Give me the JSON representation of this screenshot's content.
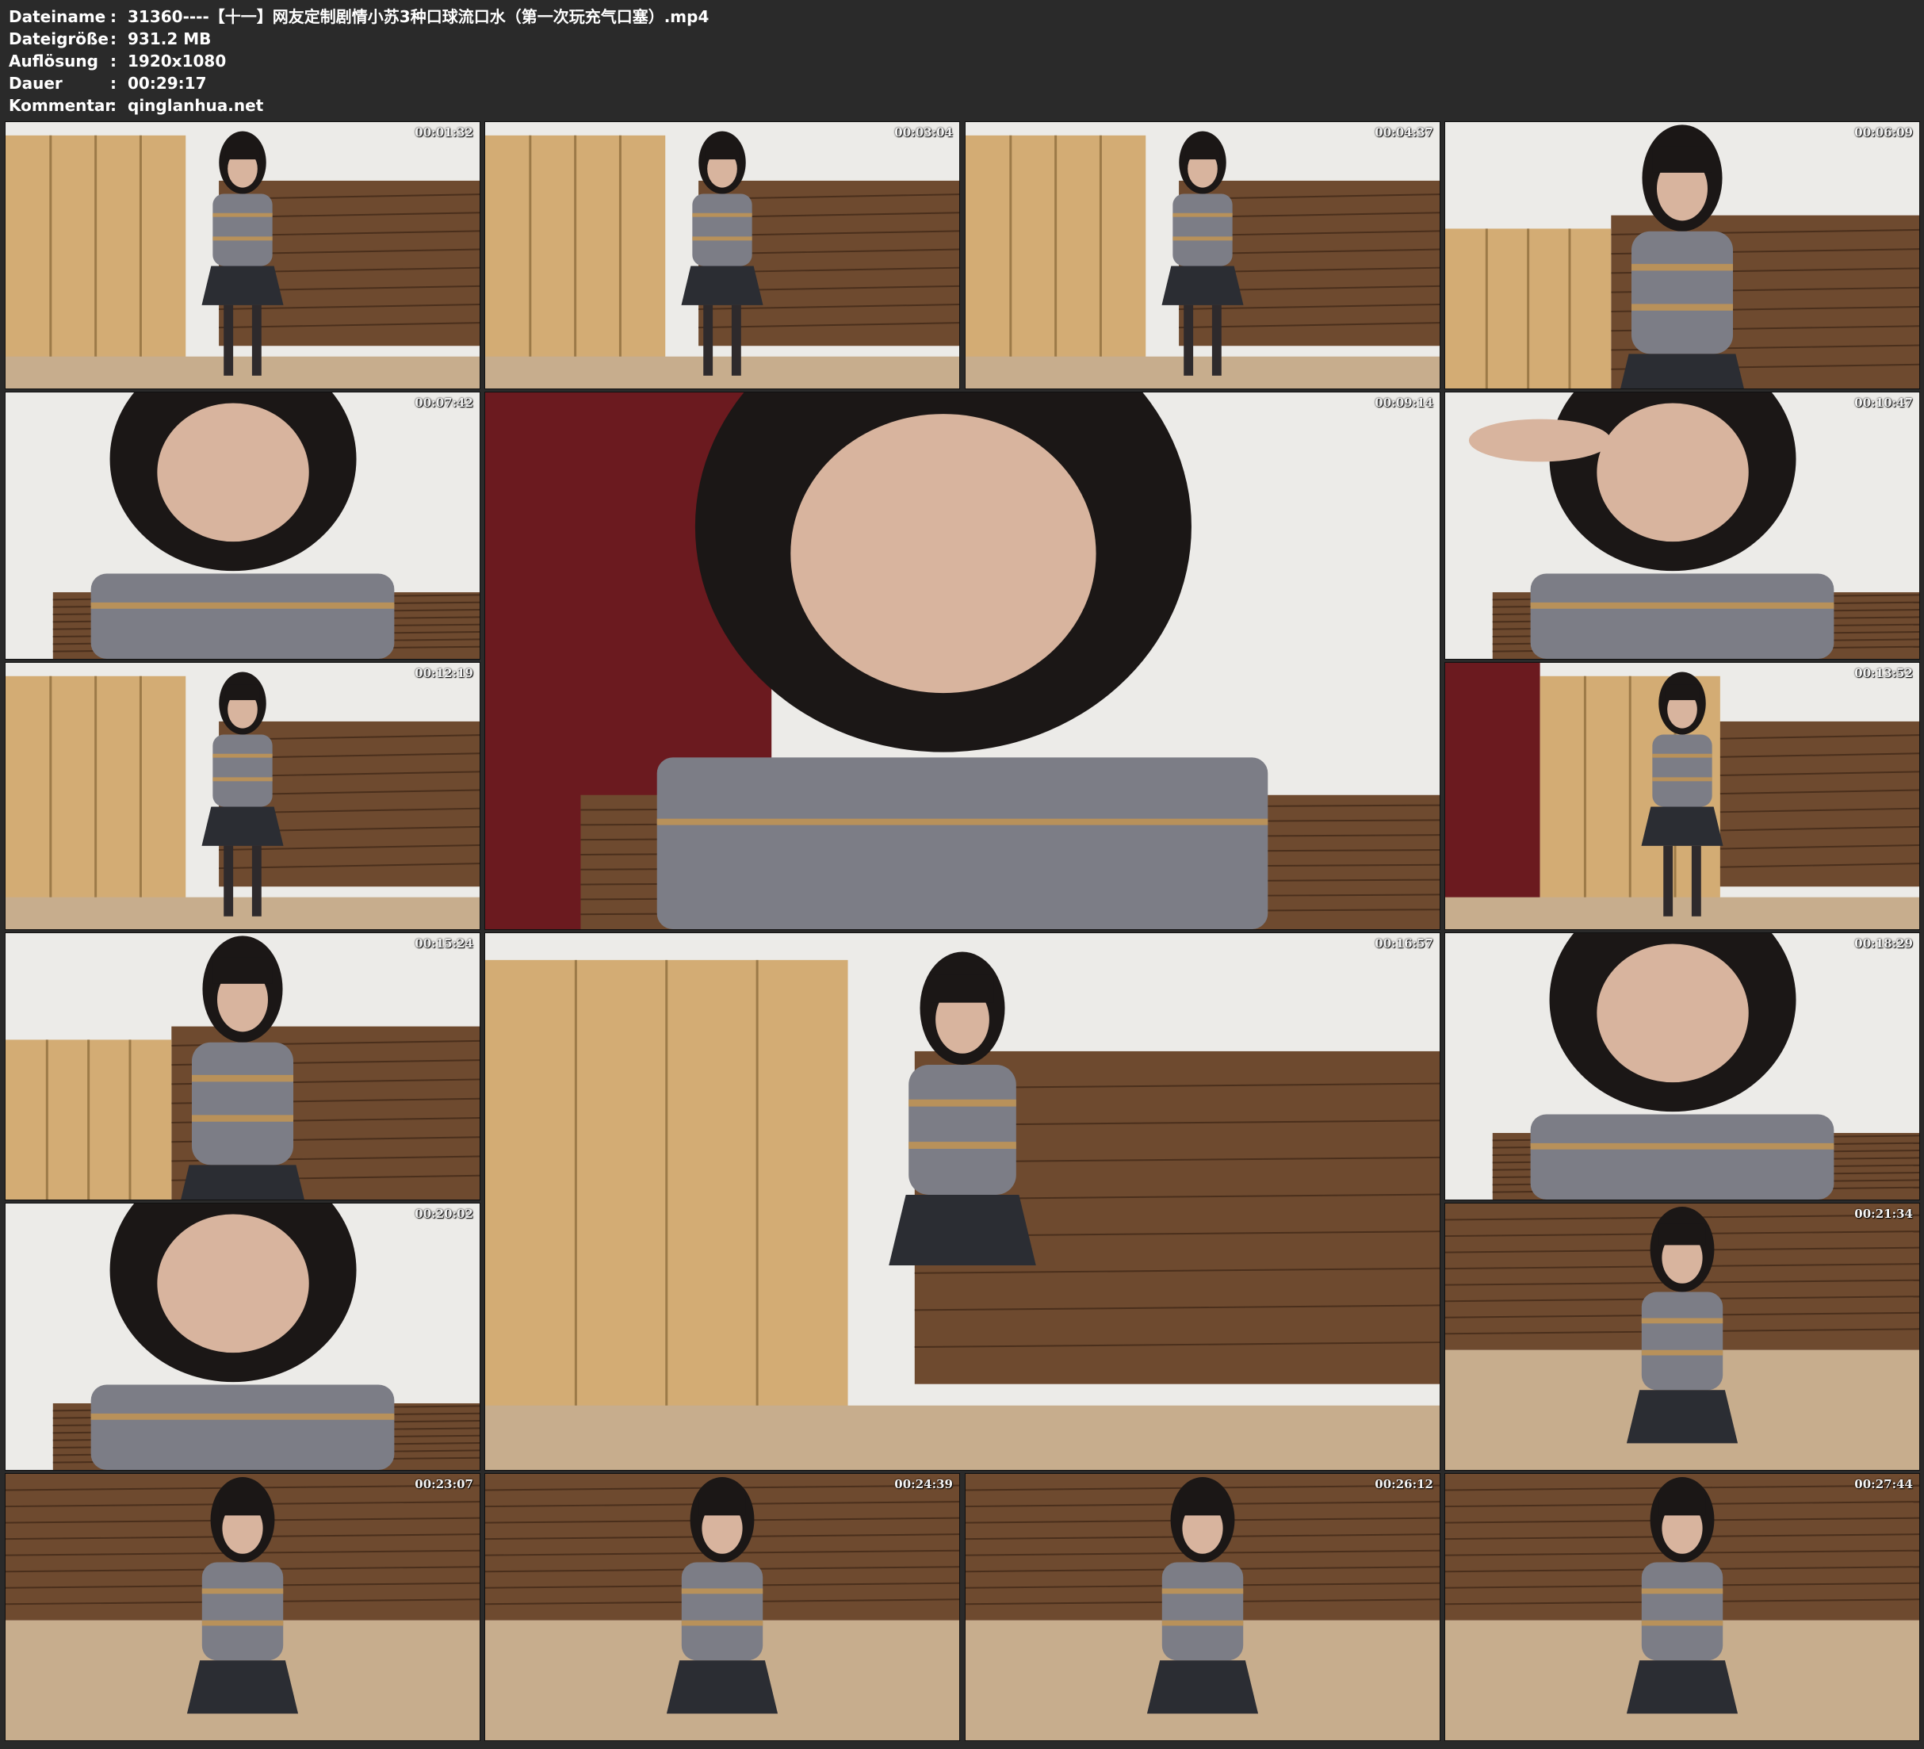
{
  "header": {
    "filename_label": "Dateiname",
    "filename": "31360----【十一】网友定制剧情小苏3种口球流口水（第一次玩充气口塞）.mp4",
    "filesize_label": "Dateigröße",
    "filesize": "931.2 MB",
    "resolution_label": "Auflösung",
    "resolution": "1920x1080",
    "duration_label": "Dauer",
    "duration": "00:29:17",
    "comment_label": "Kommentar",
    "comment": "qinglanhua.net",
    "separator": ":"
  },
  "thumbnails": [
    {
      "timestamp": "00:01:32",
      "scene": "standing-wall"
    },
    {
      "timestamp": "00:03:04",
      "scene": "standing-wall"
    },
    {
      "timestamp": "00:04:37",
      "scene": "standing-wall"
    },
    {
      "timestamp": "00:06:09",
      "scene": "upper-body"
    },
    {
      "timestamp": "00:07:42",
      "scene": "closeup"
    },
    {
      "timestamp": "00:09:14",
      "scene": "closeup-door"
    },
    {
      "timestamp": "00:10:47",
      "scene": "closeup-hand"
    },
    {
      "timestamp": "00:12:19",
      "scene": "standing-wall"
    },
    {
      "timestamp": "00:13:52",
      "scene": "standing-door"
    },
    {
      "timestamp": "00:15:24",
      "scene": "upper-body"
    },
    {
      "timestamp": "00:16:57",
      "scene": "seated-wall"
    },
    {
      "timestamp": "00:18:29",
      "scene": "closeup"
    },
    {
      "timestamp": "00:20:02",
      "scene": "closeup"
    },
    {
      "timestamp": "00:21:34",
      "scene": "kneeling"
    },
    {
      "timestamp": "00:23:07",
      "scene": "kneeling"
    },
    {
      "timestamp": "00:24:39",
      "scene": "kneeling"
    },
    {
      "timestamp": "00:26:12",
      "scene": "kneeling"
    },
    {
      "timestamp": "00:27:44",
      "scene": "kneeling"
    }
  ],
  "colors": {
    "background": "#2a2a2a",
    "text": "#ffffff",
    "wall": "#ecebe8",
    "wood": "#6e4a2f",
    "screen": "#d3ac74",
    "door": "#6b1a1f",
    "floor": "#c7ad8d",
    "hair": "#1b1716",
    "shirt": "#7c7d86",
    "skirt": "#2b2d33",
    "skin": "#d8b49e",
    "rope": "#b8915a"
  }
}
